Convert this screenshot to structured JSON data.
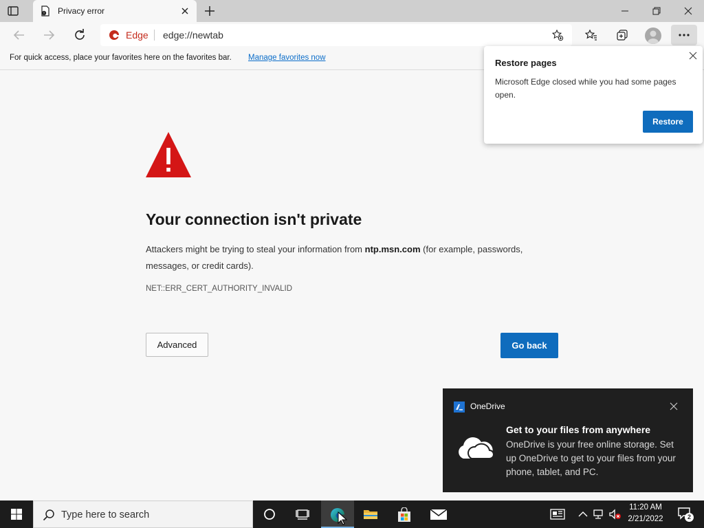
{
  "browser": {
    "tab": {
      "title": "Privacy error"
    },
    "address_bar": {
      "brand": "Edge",
      "url": "edge://newtab"
    },
    "favorites_hint": {
      "text": "For quick access, place your favorites here on the favorites bar.",
      "link": "Manage favorites now"
    }
  },
  "error_page": {
    "heading": "Your connection isn't private",
    "description_before": "Attackers might be trying to steal your information from ",
    "host": "ntp.msn.com",
    "description_after": " (for example, passwords, messages, or credit cards).",
    "error_code": "NET::ERR_CERT_AUTHORITY_INVALID",
    "advanced_label": "Advanced",
    "go_back_label": "Go back"
  },
  "restore_popup": {
    "title": "Restore pages",
    "message": "Microsoft Edge closed while you had some pages open.",
    "button_label": "Restore"
  },
  "onedrive_toast": {
    "app_name": "OneDrive",
    "title": "Get to your files from anywhere",
    "body": "OneDrive is your free online storage. Set up OneDrive to get to your files from your phone, tablet, and PC."
  },
  "taskbar": {
    "search_placeholder": "Type here to search",
    "time": "11:20 AM",
    "date": "2/21/2022",
    "notification_count": "2"
  },
  "colors": {
    "accent_blue": "#0f6cbd",
    "warning_red": "#d41616",
    "link_blue": "#0b6dc9",
    "edge_red": "#c42b1c"
  },
  "icons": [
    "tab-actions-icon",
    "page-icon",
    "close-icon",
    "plus-icon",
    "minimize-icon",
    "maximize-icon",
    "back-arrow-icon",
    "forward-arrow-icon",
    "refresh-icon",
    "edge-logo-icon",
    "add-favorite-icon",
    "favorites-icon",
    "collections-icon",
    "profile-icon",
    "more-icon",
    "warning-icon",
    "onedrive-icon",
    "cloud-icon",
    "windows-logo-icon",
    "search-icon",
    "cortana-icon",
    "task-view-icon",
    "edge-icon",
    "folder-icon",
    "store-icon",
    "mail-icon",
    "news-icon",
    "chevron-up-icon",
    "network-icon",
    "volume-muted-icon",
    "notifications-icon",
    "cursor-icon"
  ]
}
